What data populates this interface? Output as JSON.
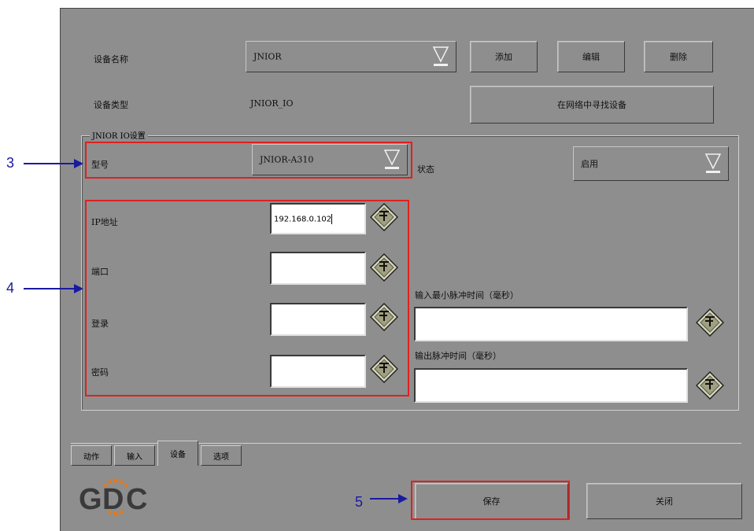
{
  "device_section": {
    "name_label": "设备名称",
    "name_value": "JNIOR",
    "type_label": "设备类型",
    "type_value": "JNIOR_IO",
    "add_label": "添加",
    "edit_label": "编辑",
    "delete_label": "删除",
    "find_label": "在网络中寻找设备"
  },
  "settings_group": {
    "title": "JNIOR IO设置",
    "model_label": "型号",
    "model_value": "JNIOR-A310",
    "status_label": "状态",
    "status_value": "启用",
    "ip_label": "IP地址",
    "ip_value": "192.168.0.102",
    "port_label": "端口",
    "port_value": "",
    "login_label": "登录",
    "login_value": "",
    "password_label": "密码",
    "password_value": "",
    "input_pulse_label": "输入最小脉冲时间（毫秒）",
    "input_pulse_value": "",
    "output_pulse_label": "输出脉冲时间（毫秒）",
    "output_pulse_value": ""
  },
  "tabs": [
    "动作",
    "输入",
    "设备",
    "选项"
  ],
  "active_tab": "设备",
  "logo": "GDC",
  "footer": {
    "save_label": "保存",
    "close_label": "关闭"
  },
  "callouts": [
    "3",
    "4",
    "5"
  ],
  "icons": {
    "dropdown": "dropdown-arrow-icon",
    "keyboard": "keyboard-icon"
  },
  "colors": {
    "window_bg": "#8e8e8e",
    "highlight_box": "#e02020",
    "callout": "#1a1aa0"
  }
}
